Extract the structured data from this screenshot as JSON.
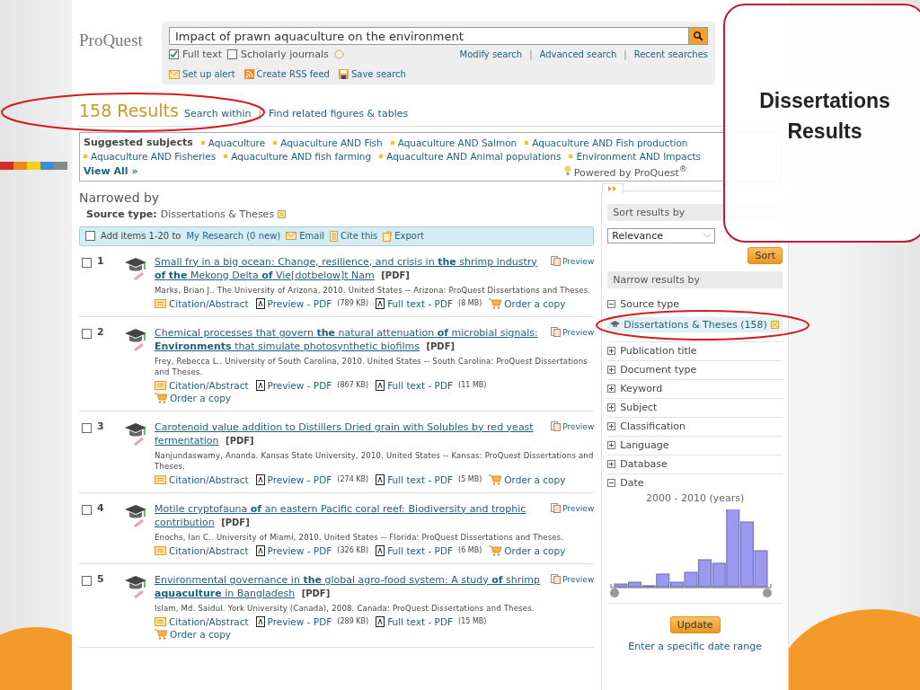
{
  "logo": "ProQuest",
  "search": {
    "value": "Impact of prawn aquaculture on the environment",
    "separator": "|",
    "options": [
      {
        "label": "Full text",
        "checked": true
      },
      {
        "label": "Scholarly journals",
        "checked": false
      }
    ],
    "links": [
      "Modify search",
      "Advanced search",
      "Recent searches"
    ]
  },
  "actions": [
    {
      "kind": "alert",
      "label": "Set up alert"
    },
    {
      "kind": "rss",
      "label": "Create RSS feed"
    },
    {
      "kind": "save",
      "label": "Save search"
    }
  ],
  "results_header": {
    "count": "158 Results",
    "separator": "|",
    "links": [
      "Search within",
      "Find related figures & tables"
    ]
  },
  "suggested": {
    "label": "Suggested subjects",
    "items": [
      "Aquaculture",
      "Aquaculture AND Fish",
      "Aquaculture AND Salmon",
      "Aquaculture AND Fish production",
      "Aquaculture AND Fisheries",
      "Aquaculture AND fish farming",
      "Aquaculture AND Animal populations",
      "Environment AND Impacts"
    ],
    "view_all": "View All »",
    "powered": "Powered by ProQuest$^{®}$"
  },
  "narrowed": {
    "title": "Narrowed by",
    "label": "Source type:",
    "value": "Dissertations & Theses"
  },
  "toolbar": {
    "checked": false,
    "text": "Add items 1-20 to",
    "link": "My Research (0 new)",
    "actions": [
      {
        "kind": "email",
        "label": "Email"
      },
      {
        "kind": "cite",
        "label": "Cite this"
      },
      {
        "kind": "export",
        "label": "Export"
      }
    ]
  },
  "results": [
    {
      "number": "1",
      "checked": false,
      "title": "Small fry in a big ocean: Change, resilience, and crisis in **the** shrimp industry **of** **the** Mekong Delta **of** Vie[dotbelow]t Nam",
      "tag": "[PDF]",
      "preview": "Preview",
      "meta": "Marks, Brian J.. The University of Arizona, 2010. United States -- Arizona: ProQuest Dissertations and Theses.",
      "links": [
        {
          "kind": "abstract",
          "label": "Citation/Abstract"
        },
        {
          "kind": "pdf",
          "label": "Preview - PDF",
          "size": "(789 KB)"
        },
        {
          "kind": "pdf",
          "label": "Full text - PDF",
          "size": "(8 MB)"
        },
        {
          "kind": "order",
          "label": "Order a copy"
        }
      ]
    },
    {
      "number": "2",
      "checked": false,
      "title": "Chemical processes that govern **the** natural attenuation **of** microbial signals: **Environments** that simulate photosynthetic biofilms",
      "tag": "[PDF]",
      "preview": "Preview",
      "meta": "Frey, Rebecca L.. University of South Carolina, 2010. United States -- South Carolina: ProQuest Dissertations and Theses.",
      "links": [
        {
          "kind": "abstract",
          "label": "Citation/Abstract"
        },
        {
          "kind": "pdf",
          "label": "Preview - PDF",
          "size": "(867 KB)"
        },
        {
          "kind": "pdf",
          "label": "Full text - PDF",
          "size": "(11 MB)"
        },
        {
          "kind": "order",
          "label": "Order a copy"
        }
      ]
    },
    {
      "number": "3",
      "checked": false,
      "title": "Carotenoid value addition to Distillers Dried grain with Solubles by red yeast fermentation",
      "tag": "[PDF]",
      "preview": "Preview",
      "meta": "Nanjundaswamy, Ananda. Kansas State University, 2010. United States -- Kansas: ProQuest Dissertations and Theses.",
      "links": [
        {
          "kind": "abstract",
          "label": "Citation/Abstract"
        },
        {
          "kind": "pdf",
          "label": "Preview - PDF",
          "size": "(274 KB)"
        },
        {
          "kind": "pdf",
          "label": "Full text - PDF",
          "size": "(5 MB)"
        },
        {
          "kind": "order",
          "label": "Order a copy"
        }
      ]
    },
    {
      "number": "4",
      "checked": false,
      "title": "Motile cryptofauna **of** an eastern Pacific coral reef: Biodiversity and trophic contribution",
      "tag": "[PDF]",
      "preview": "Preview",
      "meta": "Enochs, Ian C.. University of Miami, 2010. United States -- Florida: ProQuest Dissertations and Theses.",
      "links": [
        {
          "kind": "abstract",
          "label": "Citation/Abstract"
        },
        {
          "kind": "pdf",
          "label": "Preview - PDF",
          "size": "(326 KB)"
        },
        {
          "kind": "pdf",
          "label": "Full text - PDF",
          "size": "(6 MB)"
        },
        {
          "kind": "order",
          "label": "Order a copy"
        }
      ]
    },
    {
      "number": "5",
      "checked": false,
      "title": "Environmental governance in **the** global agro-food system: A study **of** shrimp **aquaculture** in Bangladesh",
      "tag": "[PDF]",
      "preview": "Preview",
      "meta": "Islam, Md. Saidul. York University (Canada), 2008. Canada: ProQuest Dissertations and Theses.",
      "links": [
        {
          "kind": "abstract",
          "label": "Citation/Abstract"
        },
        {
          "kind": "pdf",
          "label": "Preview - PDF",
          "size": "(289 KB)"
        },
        {
          "kind": "pdf",
          "label": "Full text - PDF",
          "size": "(15 MB)"
        },
        {
          "kind": "order",
          "label": "Order a copy"
        }
      ]
    }
  ],
  "sidebar": {
    "sort_title": "Sort results by",
    "sort_value": "Relevance",
    "sort_button": "Sort",
    "narrow_title": "Narrow results by",
    "facets": [
      {
        "label": "Source type",
        "expanded": true,
        "children": [
          {
            "label": "Dissertations & Theses (158)",
            "selected": true
          }
        ]
      },
      {
        "label": "Publication title",
        "expanded": false
      },
      {
        "label": "Document type",
        "expanded": false
      },
      {
        "label": "Keyword",
        "expanded": false
      },
      {
        "label": "Subject",
        "expanded": false
      },
      {
        "label": "Classification",
        "expanded": false
      },
      {
        "label": "Language",
        "expanded": false
      },
      {
        "label": "Database",
        "expanded": false
      },
      {
        "label": "Date",
        "expanded": true,
        "range": "2000 - 2010 (years)"
      }
    ],
    "update_button": "Update",
    "date_link": "Enter a specific date range"
  },
  "callout": "Dissertations Results"
}
